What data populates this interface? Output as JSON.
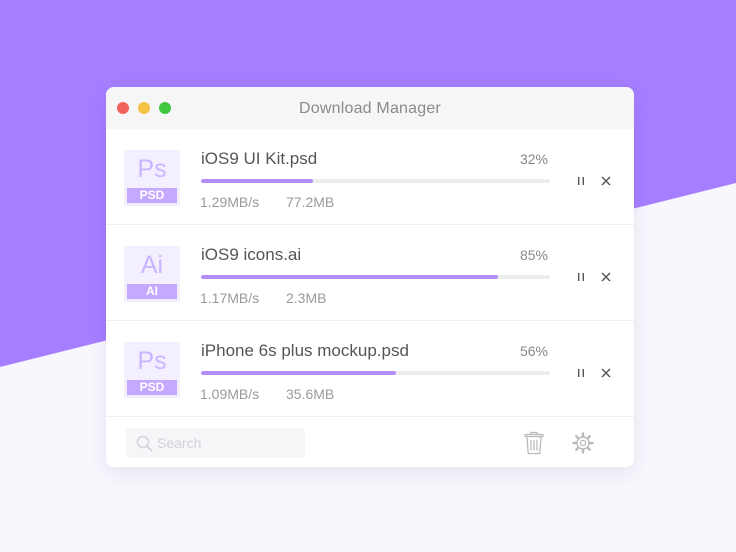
{
  "window": {
    "title": "Download Manager"
  },
  "colors": {
    "background_top": "#a57fff",
    "background_bottom": "#f8f7fd",
    "accent": "#b58dfb",
    "icon_tile": "#f3efff",
    "icon_badge": "#c5a8ff"
  },
  "downloads": [
    {
      "icon": "photoshop-file-icon",
      "icon_abbr": "Ps",
      "icon_ext": "PSD",
      "name": "iOS9 UI Kit.psd",
      "percent_label": "32%",
      "progress": 0.32,
      "speed": "1.29MB/s",
      "size": "77.2MB"
    },
    {
      "icon": "illustrator-file-icon",
      "icon_abbr": "Ai",
      "icon_ext": "AI",
      "name": "iOS9 icons.ai",
      "percent_label": "85%",
      "progress": 0.85,
      "speed": "1.17MB/s",
      "size": "2.3MB"
    },
    {
      "icon": "photoshop-file-icon",
      "icon_abbr": "Ps",
      "icon_ext": "PSD",
      "name": "iPhone 6s plus mockup.psd",
      "percent_label": "56%",
      "progress": 0.56,
      "speed": "1.09MB/s",
      "size": "35.6MB"
    }
  ],
  "footer": {
    "search_placeholder": "Search",
    "search_value": "",
    "trash_icon": "trash-icon",
    "settings_icon": "gear-icon"
  }
}
